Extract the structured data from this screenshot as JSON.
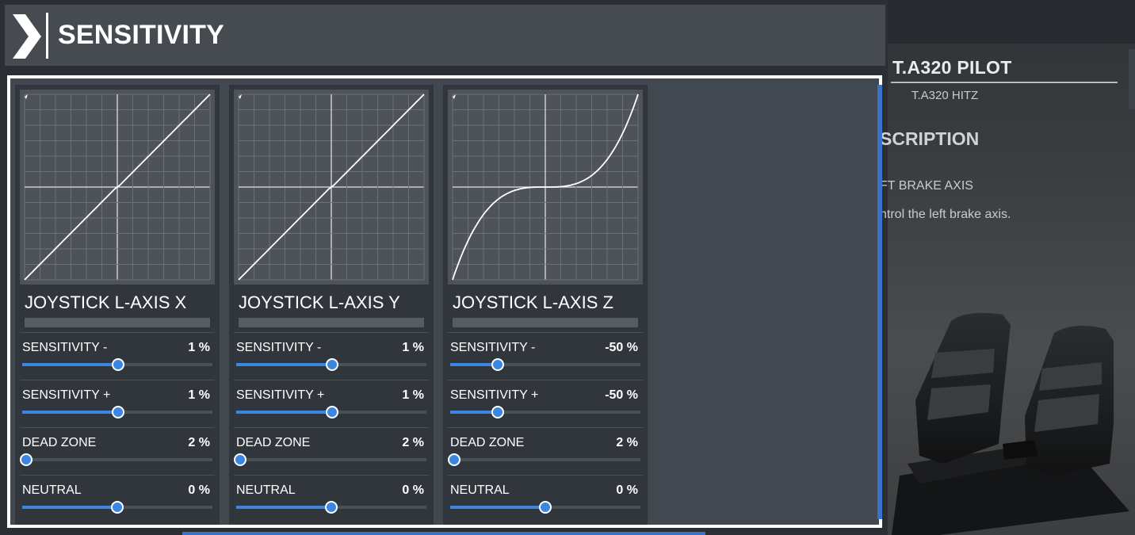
{
  "header": {
    "title": "SENSITIVITY"
  },
  "right_panel": {
    "profile_title": "T.A320 PILOT",
    "profile_sub": "T.A320 HITZ",
    "description_heading": "SCRIPTION",
    "description_line1": "FT BRAKE AXIS",
    "description_line2": "ntrol the left brake axis."
  },
  "axes": [
    {
      "name": "JOYSTICK L-AXIS X",
      "curve": "linear",
      "params": [
        {
          "label": "SENSITIVITY -",
          "value_text": "1 %",
          "fraction": 0.505
        },
        {
          "label": "SENSITIVITY +",
          "value_text": "1 %",
          "fraction": 0.505
        },
        {
          "label": "DEAD ZONE",
          "value_text": "2 %",
          "fraction": 0.02
        },
        {
          "label": "NEUTRAL",
          "value_text": "0 %",
          "fraction": 0.5
        }
      ]
    },
    {
      "name": "JOYSTICK L-AXIS Y",
      "curve": "linear",
      "params": [
        {
          "label": "SENSITIVITY -",
          "value_text": "1 %",
          "fraction": 0.505
        },
        {
          "label": "SENSITIVITY +",
          "value_text": "1 %",
          "fraction": 0.505
        },
        {
          "label": "DEAD ZONE",
          "value_text": "2 %",
          "fraction": 0.02
        },
        {
          "label": "NEUTRAL",
          "value_text": "0 %",
          "fraction": 0.5
        }
      ]
    },
    {
      "name": "JOYSTICK L-AXIS Z",
      "curve": "cubic",
      "params": [
        {
          "label": "SENSITIVITY -",
          "value_text": "-50 %",
          "fraction": 0.25
        },
        {
          "label": "SENSITIVITY +",
          "value_text": "-50 %",
          "fraction": 0.25
        },
        {
          "label": "DEAD ZONE",
          "value_text": "2 %",
          "fraction": 0.02
        },
        {
          "label": "NEUTRAL",
          "value_text": "0 %",
          "fraction": 0.5
        }
      ]
    }
  ],
  "colors": {
    "accent": "#3a86e0",
    "panel_bg": "#414850",
    "card_bg": "#30363c",
    "graph_bg": "#4e535a"
  },
  "icons": [
    "chevron-right-icon",
    "rudder-pedals-image"
  ]
}
